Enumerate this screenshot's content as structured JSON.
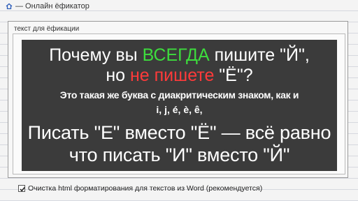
{
  "breadcrumb": {
    "home_icon": "home-icon",
    "title": "— Онлайн ёфикатор"
  },
  "form": {
    "legend": "текст для ёфикации"
  },
  "image_text": {
    "l1_a": "Почему вы ",
    "l1_b": "ВСЕГДА",
    "l1_c": " пишите \"Й\",",
    "l2_a": "но ",
    "l2_b": "не пишете",
    "l2_c": " \"Ё\"?",
    "l3": "Это такая же буква с диакритическим знаком, как и",
    "l4": "i, j, é, è, ê,",
    "l5": "Писать \"Е\" вместо \"Ё\" — всё равно",
    "l6": "что писать \"И\" вместо \"Й\""
  },
  "colors": {
    "panel_bg": "#3b3b3b",
    "highlight_green": "#3ddc3d",
    "highlight_red": "#ff3a3a"
  },
  "option": {
    "checked": true,
    "label": "Очистка html форматирования для текстов из Word (рекомендуется)"
  }
}
